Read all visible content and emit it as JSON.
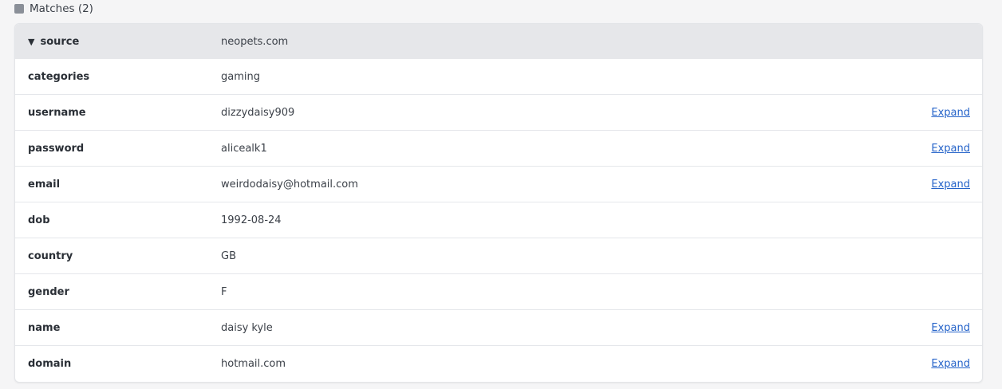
{
  "section": {
    "title": "Matches (2)"
  },
  "record": {
    "header": {
      "key": "source",
      "value": "neopets.com"
    },
    "fields": [
      {
        "key": "categories",
        "value": "gaming",
        "expand": ""
      },
      {
        "key": "username",
        "value": "dizzydaisy909",
        "expand": "Expand"
      },
      {
        "key": "password",
        "value": "alicealk1",
        "expand": "Expand"
      },
      {
        "key": "email",
        "value": "weirdodaisy@hotmail.com",
        "expand": "Expand"
      },
      {
        "key": "dob",
        "value": "1992-08-24",
        "expand": ""
      },
      {
        "key": "country",
        "value": "GB",
        "expand": ""
      },
      {
        "key": "gender",
        "value": "F",
        "expand": ""
      },
      {
        "key": "name",
        "value": "daisy kyle",
        "expand": "Expand"
      },
      {
        "key": "domain",
        "value": "hotmail.com",
        "expand": "Expand"
      }
    ]
  },
  "colors": {
    "header_bg": "#e6e7ea",
    "link": "#2563c9"
  },
  "icons": {
    "section": "square-icon",
    "collapse": "caret-down-icon"
  }
}
